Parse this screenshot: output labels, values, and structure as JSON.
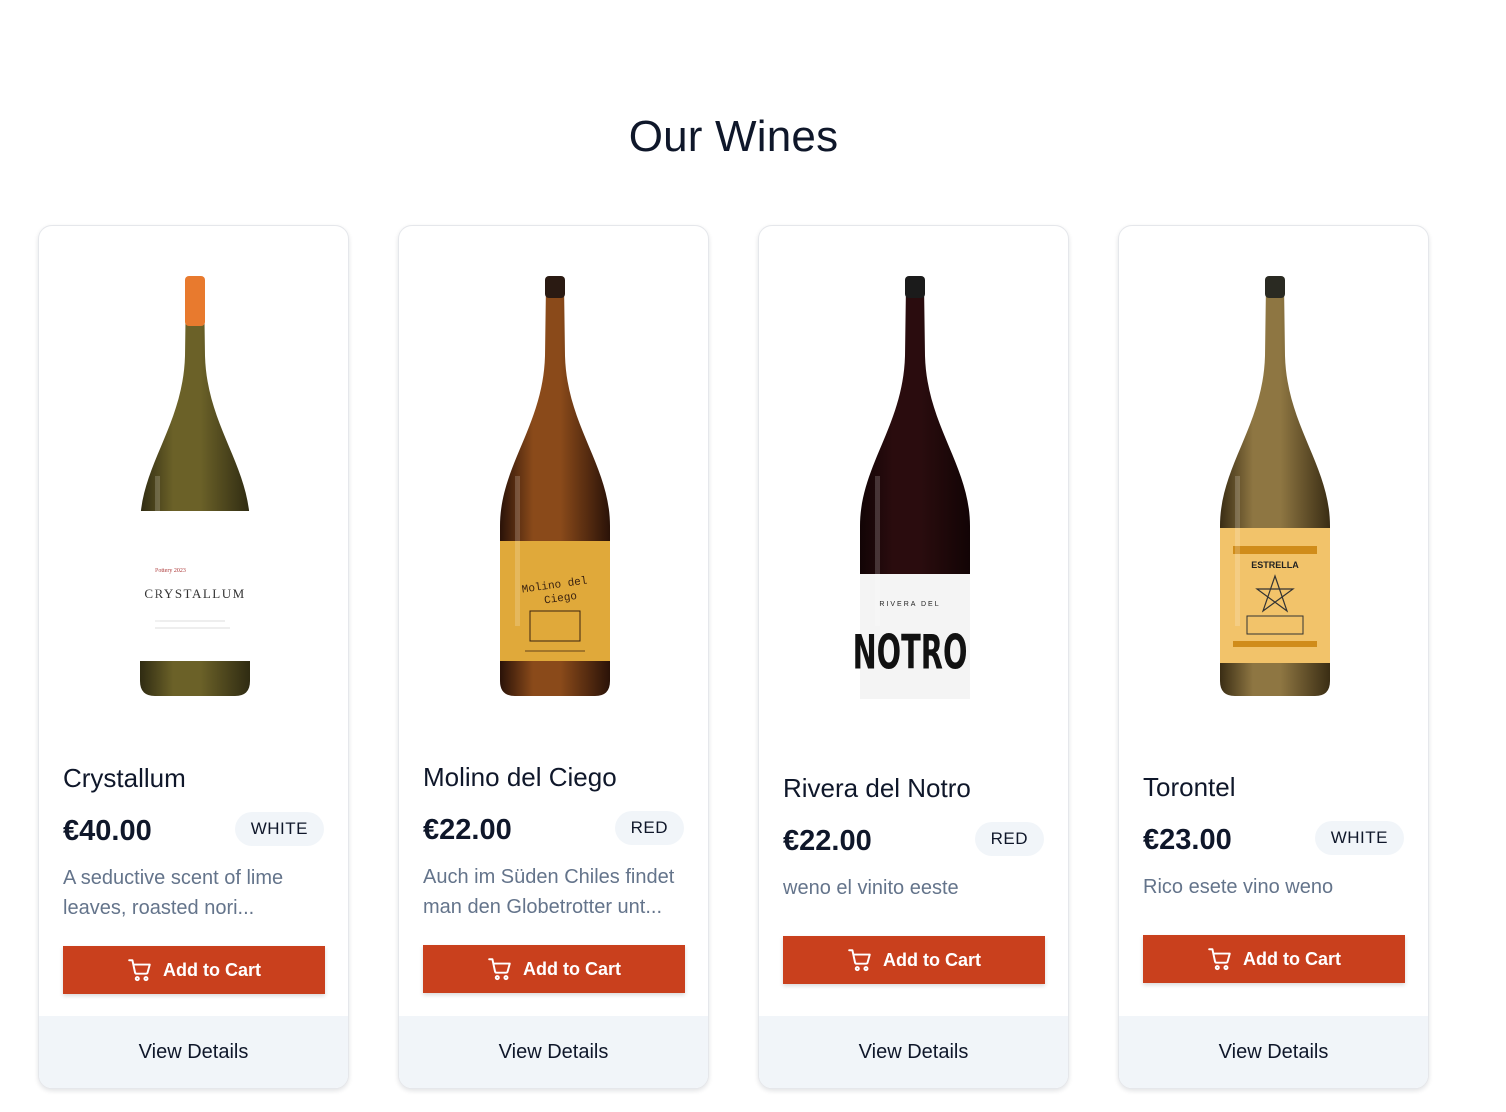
{
  "page": {
    "title": "Our Wines"
  },
  "products": [
    {
      "name": "Crystallum",
      "price": "€40.00",
      "type": "WHITE",
      "description": "A seductive scent of lime leaves, roasted nori...",
      "add_to_cart": "Add to Cart",
      "view_details": "View Details",
      "bottle": {
        "glass": "#6b6128",
        "glass_dark": "#2f2b12",
        "capsule": "#e87a2e",
        "label": "#ffffff",
        "label_text": "CRYSTALLUM"
      }
    },
    {
      "name": "Molino del Ciego",
      "price": "€22.00",
      "type": "RED",
      "description": "Auch im Süden Chiles findet man den Globetrotter unt...",
      "add_to_cart": "Add to Cart",
      "view_details": "View Details",
      "bottle": {
        "glass": "#8a4a1a",
        "glass_dark": "#2a1208",
        "capsule": "#2a1a12",
        "label": "#e0a93a",
        "label_text": "Molino del Ciego"
      }
    },
    {
      "name": "Rivera del Notro",
      "price": "€22.00",
      "type": "RED",
      "description": "weno el vinito eeste",
      "add_to_cart": "Add to Cart",
      "view_details": "View Details",
      "bottle": {
        "glass": "#2a0c0e",
        "glass_dark": "#120405",
        "capsule": "#1b1b1b",
        "label": "#f4f4f4",
        "label_text": "NOTRO"
      }
    },
    {
      "name": "Torontel",
      "price": "€23.00",
      "type": "WHITE",
      "description": "Rico esete vino weno",
      "add_to_cart": "Add to Cart",
      "view_details": "View Details",
      "bottle": {
        "glass": "#8e7642",
        "glass_dark": "#3a2d14",
        "capsule": "#2a2a22",
        "label": "#f2c36a",
        "label_text": "ESTRELLA"
      }
    }
  ]
}
